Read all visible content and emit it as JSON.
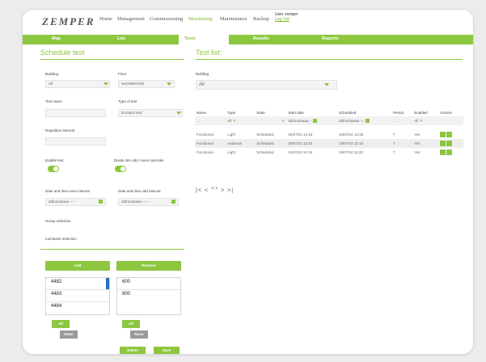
{
  "app": {
    "logo": "ZEMPER"
  },
  "nav": {
    "items": [
      "Home",
      "Management",
      "Commissioning",
      "Monitoring",
      "Maintenance",
      "Backup"
    ],
    "active": "Monitoring"
  },
  "user": {
    "name": "User zemper",
    "logout": "Log Out"
  },
  "tabs": [
    "Map",
    "List",
    "Tests",
    "Results",
    "Reports"
  ],
  "active_tab": "Tests",
  "schedule": {
    "title": "Schedule test",
    "building_label": "Building",
    "building_value": "All",
    "floor_label": "Floor",
    "floor_value": "SHOWROOM",
    "test_name_label": "Test name",
    "test_name_value": "",
    "type_label": "Type of test",
    "type_value": "Duration test",
    "rep_label": "Repetition interval",
    "rep_value": "",
    "enable_label": "Enable test",
    "enable_on": true,
    "divide_label": "Divide into odd / even intervals",
    "divide_on": true,
    "dt_even_label": "Date and time even interval",
    "dt_even_placeholder": "dd/mm/aaaa --:--",
    "dt_odd_label": "Date and time odd interval",
    "dt_odd_placeholder": "dd/mm/aaaa --:--",
    "group_label": "Group selection",
    "lum_label": "Luminaire selection",
    "add_label": "Add",
    "remove_label": "Remove",
    "list_left": [
      "4482",
      "4483",
      "4484"
    ],
    "list_right": [
      "600",
      "800"
    ],
    "all_label": "All",
    "none_label": "None",
    "delete_label": "Delete",
    "save_label": "Save"
  },
  "test_list": {
    "title": "Test list:",
    "building_label": "Building",
    "building_value": "All",
    "columns": [
      "Name",
      "Type",
      "State",
      "Start date",
      "Scheduled",
      "Period",
      "Enabled",
      "Actions"
    ],
    "filters": {
      "name": "...",
      "type": "All",
      "state": "",
      "start_date": "dd/mm/aaaa --",
      "scheduled": "dd/mm/aaaa --:-",
      "period": "...",
      "enabled": "All"
    },
    "rows": [
      {
        "name": "Functional",
        "type": "Light",
        "state": "Scheduled",
        "start": "05/07/24 14:15",
        "scheduled": "10/07/24 14:35",
        "period": "7",
        "enabled": "Yes"
      },
      {
        "name": "Functional",
        "type": "Autonom.",
        "state": "Scheduled",
        "start": "05/07/24 12:15",
        "scheduled": "10/07/24 12:15",
        "period": "7",
        "enabled": "Yes"
      },
      {
        "name": "Functional",
        "type": "Light",
        "state": "Scheduled",
        "start": "11/07/24 12:15",
        "scheduled": "18/07/24 12:20",
        "period": "7",
        "enabled": "Yes"
      }
    ],
    "pager": {
      "first": "|<",
      "prev": "<",
      "page": "1/1",
      "next": ">",
      "last": ">|"
    }
  }
}
